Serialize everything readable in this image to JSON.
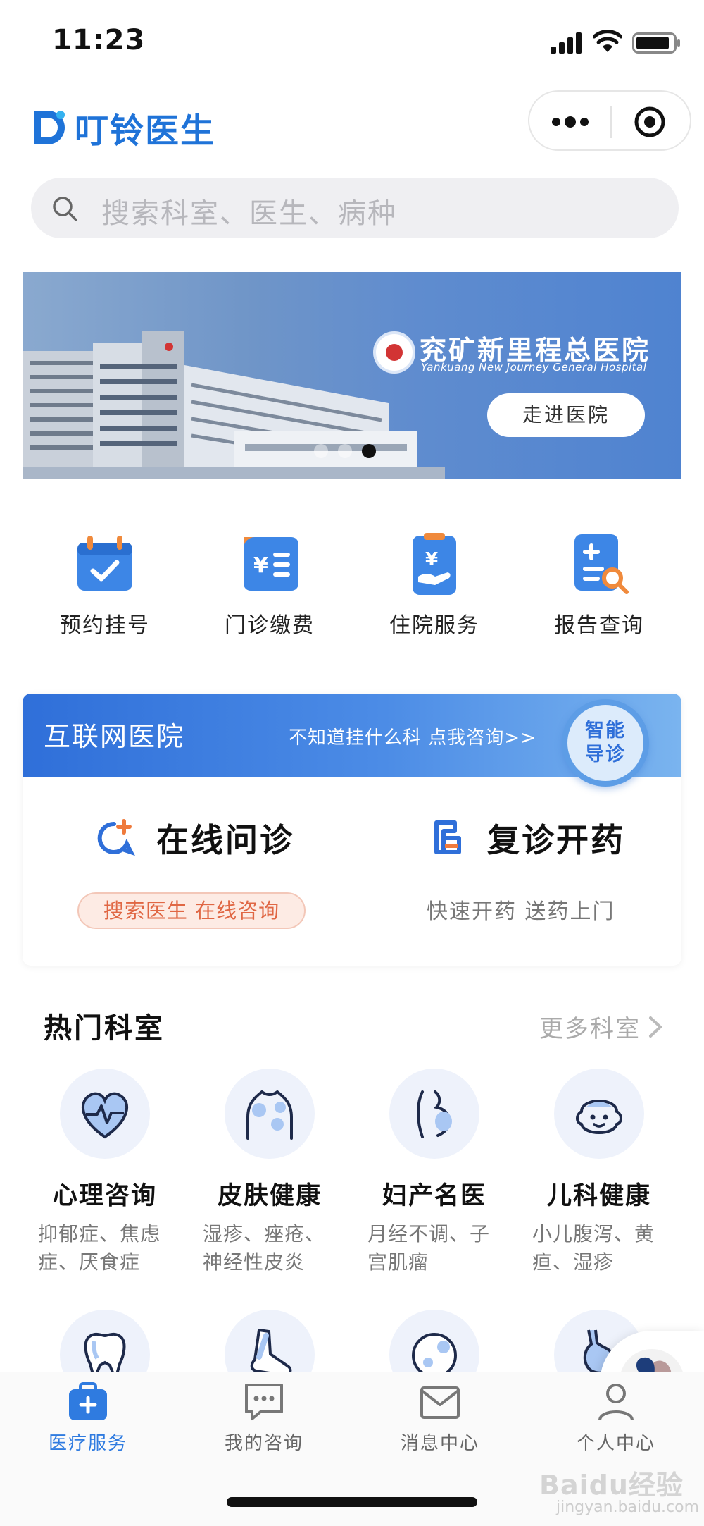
{
  "status_bar": {
    "time": "11:23"
  },
  "header": {
    "app_name": "叮铃医生"
  },
  "search": {
    "placeholder": "搜索科室、医生、病种"
  },
  "banner": {
    "hospital_name": "兖矿新里程总医院",
    "hospital_name_en": "Yankuang New Journey General Hospital",
    "enter_button": "走进医院",
    "active_slide": 3,
    "slide_count": 3
  },
  "quick_services": [
    {
      "label": "预约挂号",
      "icon": "calendar-check-icon"
    },
    {
      "label": "门诊缴费",
      "icon": "bill-payment-icon"
    },
    {
      "label": "住院服务",
      "icon": "hospital-hand-icon"
    },
    {
      "label": "报告查询",
      "icon": "report-search-icon"
    }
  ],
  "internet_hospital": {
    "title": "互联网医院",
    "hint": "不知道挂什么科 点我咨询>>",
    "smart_guide": [
      "智能",
      "导诊"
    ],
    "online_consult": {
      "title": "在线问诊",
      "sub": "搜索医生 在线咨询"
    },
    "renew_prescription": {
      "title": "复诊开药",
      "sub": "快速开药 送药上门"
    }
  },
  "hot_departments": {
    "title": "热门科室",
    "more": "更多科室",
    "items": [
      {
        "name": "心理咨询",
        "desc": "抑郁症、焦虑症、厌食症",
        "icon": "heart-pulse-icon"
      },
      {
        "name": "皮肤健康",
        "desc": "湿疹、痤疮、神经性皮炎",
        "icon": "skin-torso-icon"
      },
      {
        "name": "妇产名医",
        "desc": "月经不调、子宫肌瘤",
        "icon": "pregnancy-icon"
      },
      {
        "name": "儿科健康",
        "desc": "小儿腹泻、黄疸、湿疹",
        "icon": "baby-face-icon"
      }
    ],
    "row2_icons": [
      "tooth-icon",
      "foot-icon",
      "face-icon",
      "stomach-icon"
    ]
  },
  "tab_bar": [
    {
      "label": "医疗服务",
      "icon": "medkit-icon",
      "active": true
    },
    {
      "label": "我的咨询",
      "icon": "chat-bubble-icon",
      "active": false
    },
    {
      "label": "消息中心",
      "icon": "mail-icon",
      "active": false
    },
    {
      "label": "个人中心",
      "icon": "person-icon",
      "active": false
    }
  ],
  "watermark": {
    "brand": "Baidu经验",
    "url": "jingyan.baidu.com"
  },
  "colors": {
    "primary": "#2f7be0",
    "accent_orange": "#ef7a3c",
    "pill_text": "#e06744"
  }
}
